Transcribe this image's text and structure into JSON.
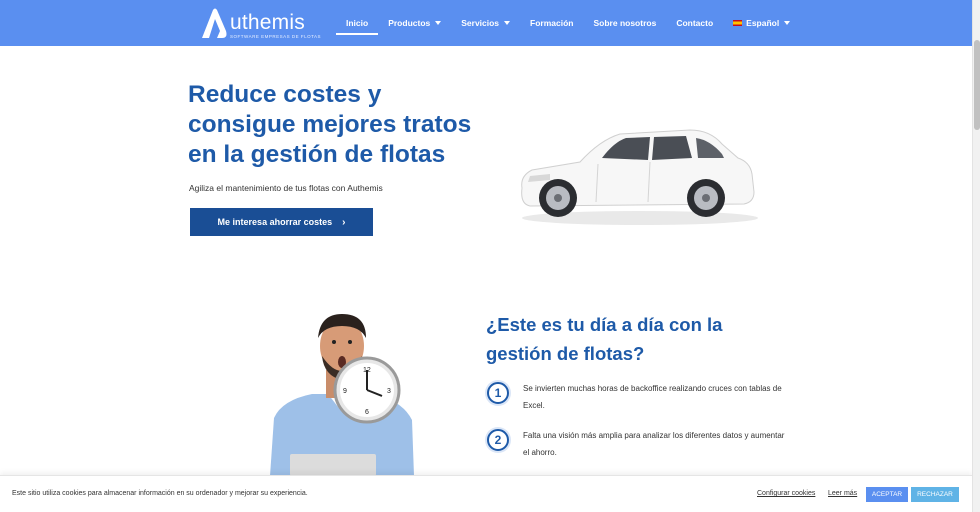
{
  "header": {
    "logo_text": "uthemis",
    "logo_tagline": "SOFTWARE EMPRESAS DE FLOTAS",
    "nav": [
      {
        "label": "Inicio"
      },
      {
        "label": "Productos"
      },
      {
        "label": "Servicios"
      },
      {
        "label": "Formación"
      },
      {
        "label": "Sobre nosotros"
      },
      {
        "label": "Contacto"
      },
      {
        "label": "Español"
      }
    ]
  },
  "hero": {
    "title": "Reduce costes y consigue mejores tratos en la gestión de flotas",
    "subtitle": "Agiliza el mantenimiento de tus flotas con Authemis",
    "cta_label": "Me interesa ahorrar costes",
    "cta_icon": "chevron-right-icon"
  },
  "section2": {
    "title": "¿Este es tu día a día con la gestión de flotas?",
    "items": [
      {
        "number": "1",
        "text": "Se invierten muchas horas de backoffice realizando cruces con tablas de Excel."
      },
      {
        "number": "2",
        "text": "Falta una visión más amplia para analizar los diferentes datos y aumentar el ahorro."
      }
    ]
  },
  "cookie_bar": {
    "text": "Este sitio utiliza cookies para almacenar información en su ordenador y mejorar su experiencia.",
    "configure_label": "Configurar cookies",
    "read_more_label": "Leer más",
    "accept_label": "ACEPTAR",
    "reject_label": "RECHAZAR"
  },
  "colors": {
    "header_bg": "#5a8ff0",
    "heading_blue": "#1e5aa8",
    "cta_bg": "#1a4e95",
    "accept_bg": "#5a8ff0",
    "reject_bg": "#5fb3e6"
  }
}
